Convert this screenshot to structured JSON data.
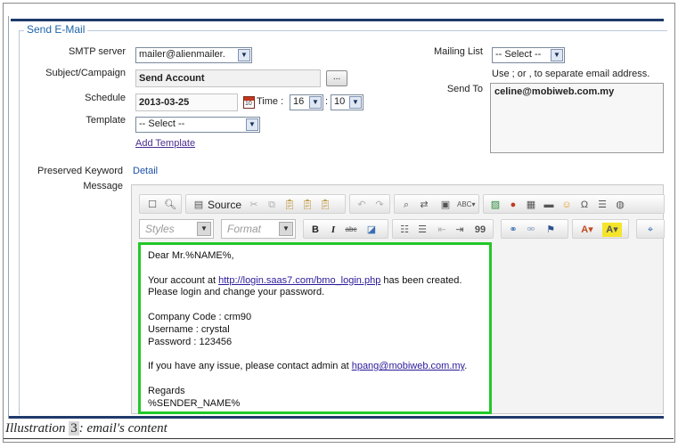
{
  "section_title": "Send E-Mail",
  "form": {
    "smtp_label": "SMTP server",
    "smtp_value": "mailer@alienmailer.",
    "subject_label": "Subject/Campaign",
    "subject_value": "Send Account",
    "subject_button": "...",
    "schedule_label": "Schedule",
    "schedule_date": "2013-03-25",
    "time_label": "Time :",
    "time_hour": "16",
    "time_sep": ":",
    "time_minute": "10",
    "template_label": "Template",
    "template_value": "-- Select --",
    "add_template_link": "Add Template",
    "mailing_list_label": "Mailing List",
    "mailing_list_value": "-- Select --",
    "send_to_hint": "Use ; or , to separate email address.",
    "send_to_label": "Send To",
    "send_to_value": "celine@mobiweb.com.my",
    "preserved_keyword_label": "Preserved Keyword",
    "detail_link": "Detail",
    "message_label": "Message"
  },
  "editor": {
    "source_label": "Source",
    "styles_placeholder": "Styles",
    "format_placeholder": "Format",
    "bold": "B",
    "italic": "I",
    "strike": "abc",
    "quote": "99"
  },
  "message": {
    "greeting": "Dear Mr.%NAME%,",
    "account_prefix": "Your account at ",
    "account_link": "http://login.saas7.com/bmo_login.php",
    "account_suffix": " has been created.",
    "login_line": "Please login and change your password.",
    "company_code": "Company Code : crm90",
    "username": "Username : crystal",
    "password": "Password : 123456",
    "issue_prefix": "If you have any issue, please contact admin at ",
    "issue_link": "hpang@mobiweb.com.my",
    "issue_suffix": ".",
    "regards": "Regards",
    "sender": "%SENDER_NAME%"
  },
  "caption": {
    "prefix": "Illustration ",
    "number": "3",
    "suffix": ": email's content"
  },
  "colors": {
    "legend": "#1d63a8",
    "highlight_border": "#21c829",
    "top_bar": "#1f3a6b"
  }
}
